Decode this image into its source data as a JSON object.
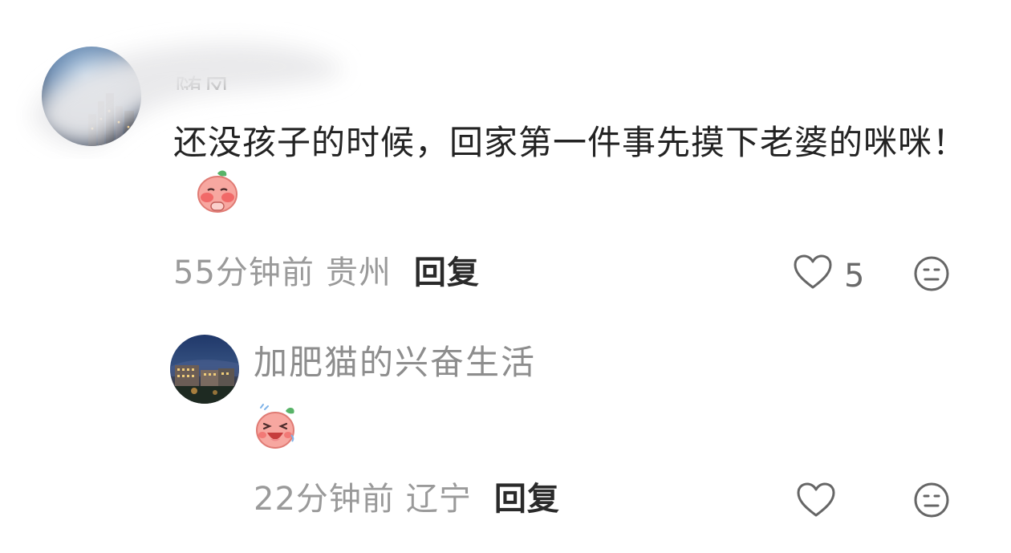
{
  "comments": [
    {
      "author": "随风",
      "text": "还没孩子的时候，回家第一件事先摸下老婆的咪咪！",
      "emoji": "blushing-peach-emoji",
      "time": "55分钟前",
      "location": "贵州",
      "reply_label": "回复",
      "like_count": "5"
    },
    {
      "author": "加肥猫的兴奋生活",
      "emoji": "laughing-peach-emoji",
      "time": "22分钟前",
      "location": "辽宁",
      "reply_label": "回复"
    }
  ],
  "colors": {
    "text_primary": "#232323",
    "text_secondary": "#9a9a9a",
    "emoji_body": "#f7a7a0",
    "emoji_leaf": "#58b368"
  },
  "icons": [
    "heart-outline-icon",
    "neutral-face-icon"
  ]
}
